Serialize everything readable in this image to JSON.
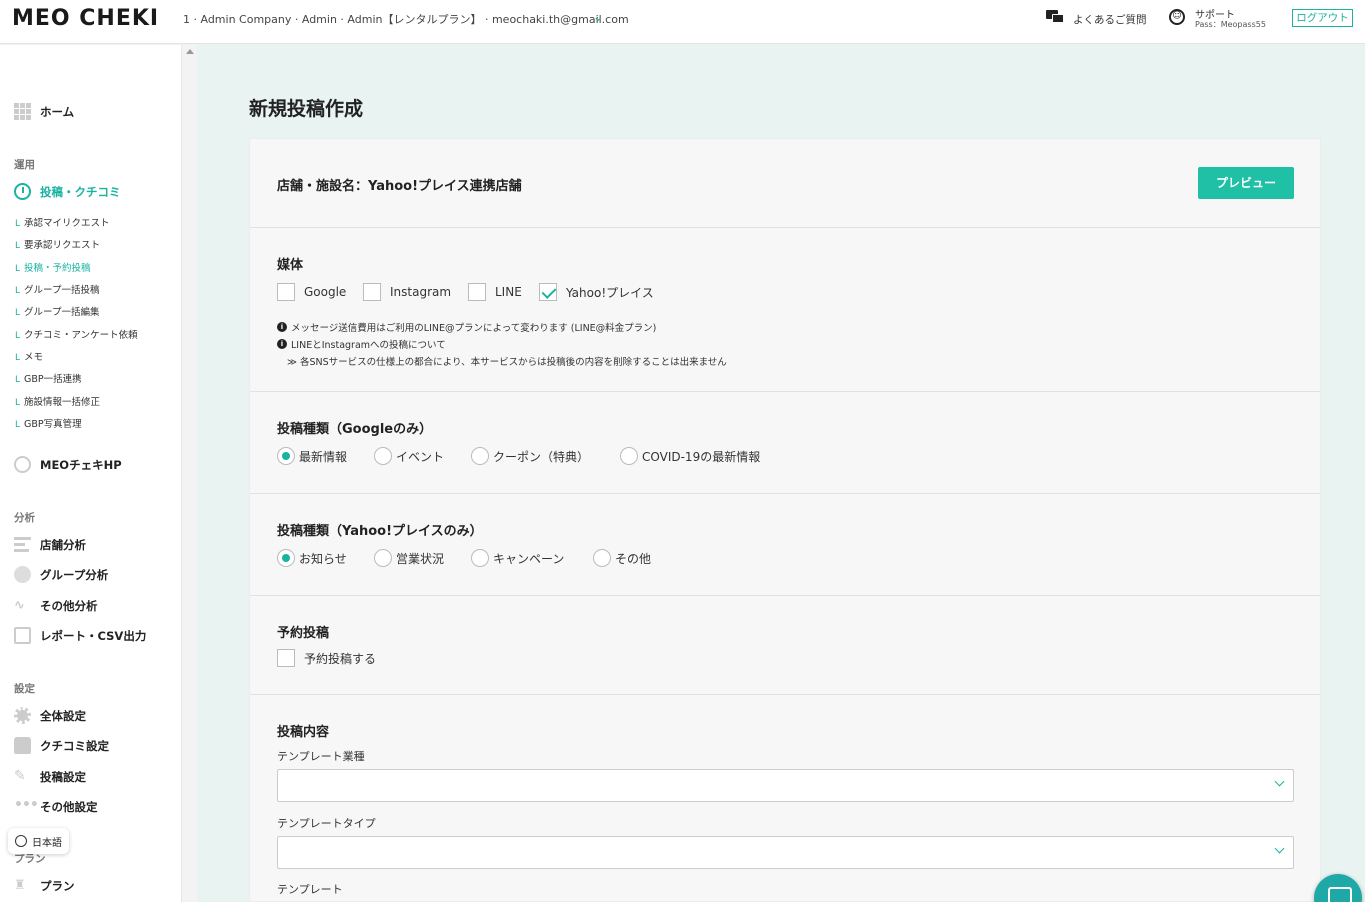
{
  "header": {
    "logo_main": "MEO CHEKI",
    "account": "1 · Admin Company · Admin · Admin【レンタルプラン】 · meochaki.th@gmail.com",
    "faq": "よくあるご質問",
    "support": "サポート",
    "support_pass": "Pass：Meopass55",
    "logout": "ログアウト"
  },
  "sidebar": {
    "home": "ホーム",
    "section_ops": "運用",
    "posts": "投稿・クチコミ",
    "sub": [
      "承認マイリクエスト",
      "要承認リクエスト",
      "投稿・予約投稿",
      "グループ一括投稿",
      "グループ一括編集",
      "クチコミ・アンケート依頼",
      "メモ",
      "GBP一括連携",
      "施設情報一括修正",
      "GBP写真管理"
    ],
    "meo_hp": "MEOチェキHP",
    "section_analysis": "分析",
    "store_analysis": "店舗分析",
    "group_analysis": "グループ分析",
    "other_analysis": "その他分析",
    "report": "レポート・CSV出力",
    "section_settings": "設定",
    "general": "全体設定",
    "review_settings": "クチコミ設定",
    "post_settings": "投稿設定",
    "other_settings": "その他設定",
    "section_plan": "プラン",
    "plan": "プラン",
    "language": "日本語"
  },
  "main": {
    "title": "新規投稿作成",
    "store_label": "店舗・施設名：Yahoo!プレイス連携店舗",
    "preview": "プレビュー",
    "media": {
      "title": "媒体",
      "options": [
        "Google",
        "Instagram",
        "LINE",
        "Yahoo!プレイス"
      ],
      "checked": "Yahoo!プレイス",
      "notes": [
        "メッセージ送信費用はご利用のLINE@プランによって変わります (LINE@料金プラン)",
        "LINEとInstagramへの投稿について",
        "≫ 各SNSサービスの仕様上の都合により、本サービスからは投稿後の内容を削除することは出来ません"
      ]
    },
    "google_type": {
      "title": "投稿種類（Googleのみ）",
      "options": [
        "最新情報",
        "イベント",
        "クーポン（特典）",
        "COVID-19の最新情報"
      ],
      "selected": "最新情報"
    },
    "yahoo_type": {
      "title": "投稿種類（Yahoo!プレイスのみ）",
      "options": [
        "お知らせ",
        "営業状況",
        "キャンペーン",
        "その他"
      ],
      "selected": "お知らせ"
    },
    "schedule": {
      "title": "予約投稿",
      "checkbox": "予約投稿する"
    },
    "content": {
      "title": "投稿内容",
      "industry_label": "テンプレート業種",
      "industry_value": "",
      "type_label": "テンプレートタイプ",
      "type_value": "",
      "template_label": "テンプレート"
    }
  },
  "colors": {
    "accent": "#1ab3a0",
    "button": "#1fc0a6",
    "background": "#e9f3f1"
  }
}
